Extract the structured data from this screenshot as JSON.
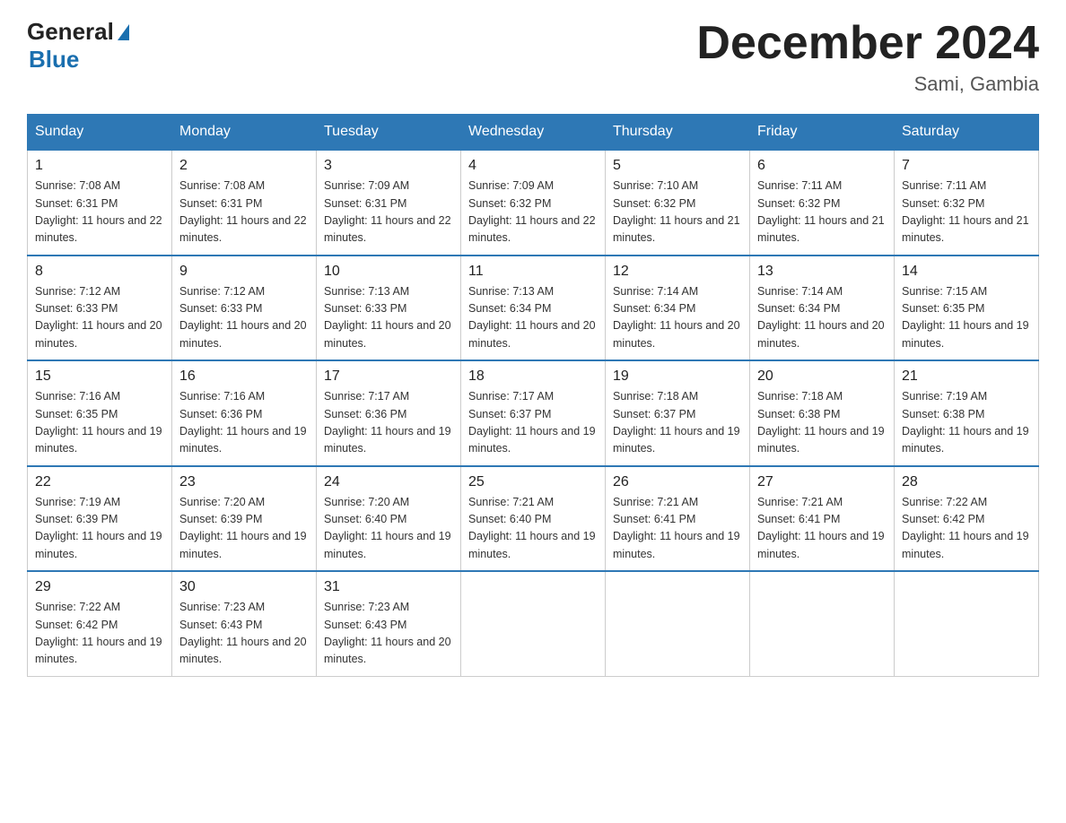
{
  "logo": {
    "line1": "General",
    "arrow": "▶",
    "line2": "Blue"
  },
  "title": "December 2024",
  "location": "Sami, Gambia",
  "days_of_week": [
    "Sunday",
    "Monday",
    "Tuesday",
    "Wednesday",
    "Thursday",
    "Friday",
    "Saturday"
  ],
  "weeks": [
    [
      {
        "day": "1",
        "sunrise": "7:08 AM",
        "sunset": "6:31 PM",
        "daylight": "11 hours and 22 minutes."
      },
      {
        "day": "2",
        "sunrise": "7:08 AM",
        "sunset": "6:31 PM",
        "daylight": "11 hours and 22 minutes."
      },
      {
        "day": "3",
        "sunrise": "7:09 AM",
        "sunset": "6:31 PM",
        "daylight": "11 hours and 22 minutes."
      },
      {
        "day": "4",
        "sunrise": "7:09 AM",
        "sunset": "6:32 PM",
        "daylight": "11 hours and 22 minutes."
      },
      {
        "day": "5",
        "sunrise": "7:10 AM",
        "sunset": "6:32 PM",
        "daylight": "11 hours and 21 minutes."
      },
      {
        "day": "6",
        "sunrise": "7:11 AM",
        "sunset": "6:32 PM",
        "daylight": "11 hours and 21 minutes."
      },
      {
        "day": "7",
        "sunrise": "7:11 AM",
        "sunset": "6:32 PM",
        "daylight": "11 hours and 21 minutes."
      }
    ],
    [
      {
        "day": "8",
        "sunrise": "7:12 AM",
        "sunset": "6:33 PM",
        "daylight": "11 hours and 20 minutes."
      },
      {
        "day": "9",
        "sunrise": "7:12 AM",
        "sunset": "6:33 PM",
        "daylight": "11 hours and 20 minutes."
      },
      {
        "day": "10",
        "sunrise": "7:13 AM",
        "sunset": "6:33 PM",
        "daylight": "11 hours and 20 minutes."
      },
      {
        "day": "11",
        "sunrise": "7:13 AM",
        "sunset": "6:34 PM",
        "daylight": "11 hours and 20 minutes."
      },
      {
        "day": "12",
        "sunrise": "7:14 AM",
        "sunset": "6:34 PM",
        "daylight": "11 hours and 20 minutes."
      },
      {
        "day": "13",
        "sunrise": "7:14 AM",
        "sunset": "6:34 PM",
        "daylight": "11 hours and 20 minutes."
      },
      {
        "day": "14",
        "sunrise": "7:15 AM",
        "sunset": "6:35 PM",
        "daylight": "11 hours and 19 minutes."
      }
    ],
    [
      {
        "day": "15",
        "sunrise": "7:16 AM",
        "sunset": "6:35 PM",
        "daylight": "11 hours and 19 minutes."
      },
      {
        "day": "16",
        "sunrise": "7:16 AM",
        "sunset": "6:36 PM",
        "daylight": "11 hours and 19 minutes."
      },
      {
        "day": "17",
        "sunrise": "7:17 AM",
        "sunset": "6:36 PM",
        "daylight": "11 hours and 19 minutes."
      },
      {
        "day": "18",
        "sunrise": "7:17 AM",
        "sunset": "6:37 PM",
        "daylight": "11 hours and 19 minutes."
      },
      {
        "day": "19",
        "sunrise": "7:18 AM",
        "sunset": "6:37 PM",
        "daylight": "11 hours and 19 minutes."
      },
      {
        "day": "20",
        "sunrise": "7:18 AM",
        "sunset": "6:38 PM",
        "daylight": "11 hours and 19 minutes."
      },
      {
        "day": "21",
        "sunrise": "7:19 AM",
        "sunset": "6:38 PM",
        "daylight": "11 hours and 19 minutes."
      }
    ],
    [
      {
        "day": "22",
        "sunrise": "7:19 AM",
        "sunset": "6:39 PM",
        "daylight": "11 hours and 19 minutes."
      },
      {
        "day": "23",
        "sunrise": "7:20 AM",
        "sunset": "6:39 PM",
        "daylight": "11 hours and 19 minutes."
      },
      {
        "day": "24",
        "sunrise": "7:20 AM",
        "sunset": "6:40 PM",
        "daylight": "11 hours and 19 minutes."
      },
      {
        "day": "25",
        "sunrise": "7:21 AM",
        "sunset": "6:40 PM",
        "daylight": "11 hours and 19 minutes."
      },
      {
        "day": "26",
        "sunrise": "7:21 AM",
        "sunset": "6:41 PM",
        "daylight": "11 hours and 19 minutes."
      },
      {
        "day": "27",
        "sunrise": "7:21 AM",
        "sunset": "6:41 PM",
        "daylight": "11 hours and 19 minutes."
      },
      {
        "day": "28",
        "sunrise": "7:22 AM",
        "sunset": "6:42 PM",
        "daylight": "11 hours and 19 minutes."
      }
    ],
    [
      {
        "day": "29",
        "sunrise": "7:22 AM",
        "sunset": "6:42 PM",
        "daylight": "11 hours and 19 minutes."
      },
      {
        "day": "30",
        "sunrise": "7:23 AM",
        "sunset": "6:43 PM",
        "daylight": "11 hours and 20 minutes."
      },
      {
        "day": "31",
        "sunrise": "7:23 AM",
        "sunset": "6:43 PM",
        "daylight": "11 hours and 20 minutes."
      },
      null,
      null,
      null,
      null
    ]
  ]
}
